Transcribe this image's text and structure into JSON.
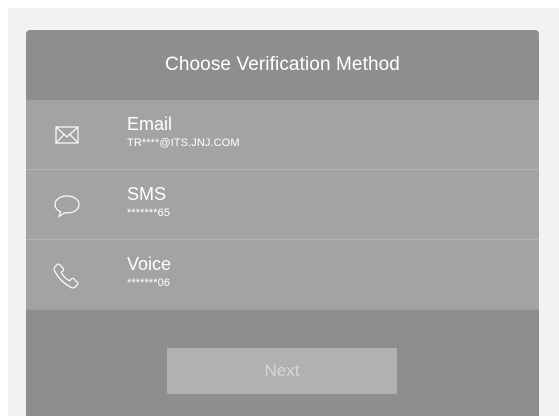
{
  "dialog": {
    "title": "Choose Verification Method"
  },
  "methods": [
    {
      "icon": "envelope-icon",
      "label": "Email",
      "detail": "TR****@ITS.JNJ.COM"
    },
    {
      "icon": "chat-bubble-icon",
      "label": "SMS",
      "detail": "*******65"
    },
    {
      "icon": "phone-icon",
      "label": "Voice",
      "detail": "*******06"
    }
  ],
  "footer": {
    "next_label": "Next"
  },
  "colors": {
    "page_background": "#f2f2f2",
    "header_background": "#8e8e8e",
    "list_background": "#a3a3a3",
    "button_background": "#b1b1b1",
    "text": "#ffffff"
  }
}
